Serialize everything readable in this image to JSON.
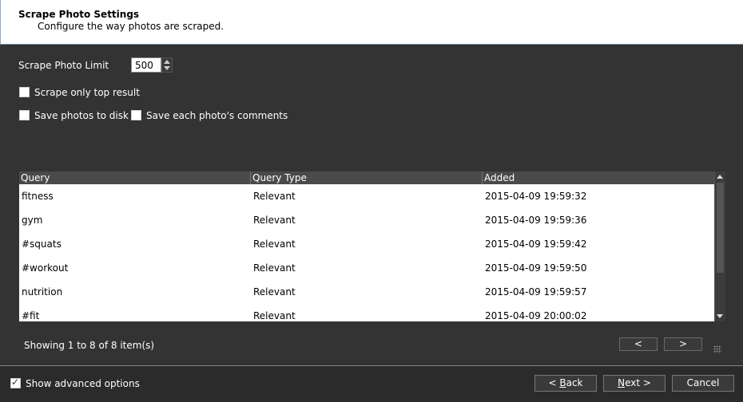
{
  "header": {
    "title": "Scrape Photo Settings",
    "subtitle": "Configure the way photos are scraped."
  },
  "settings": {
    "photo_limit_label": "Scrape Photo Limit",
    "photo_limit_value": "500",
    "scrape_top_label": "Scrape only top result",
    "scrape_top_checked": false,
    "save_disk_label": "Save photos to disk",
    "save_disk_checked": false,
    "save_comments_label": "Save each photo's comments",
    "save_comments_checked": false
  },
  "grid": {
    "columns": [
      "Query",
      "Query Type",
      "Added"
    ],
    "rows": [
      {
        "query": "fitness",
        "type": "Relevant",
        "added": "2015-04-09 19:59:32"
      },
      {
        "query": "gym",
        "type": "Relevant",
        "added": "2015-04-09 19:59:36"
      },
      {
        "query": "#squats",
        "type": "Relevant",
        "added": "2015-04-09 19:59:42"
      },
      {
        "query": "#workout",
        "type": "Relevant",
        "added": "2015-04-09 19:59:50"
      },
      {
        "query": "nutrition",
        "type": "Relevant",
        "added": "2015-04-09 19:59:57"
      },
      {
        "query": "#fit",
        "type": "Relevant",
        "added": "2015-04-09 20:00:02"
      }
    ]
  },
  "pager": {
    "status": "Showing 1 to 8 of 8 item(s)",
    "prev_label": "<",
    "next_label": ">"
  },
  "footer": {
    "advanced_label": "Show advanced options",
    "advanced_checked": true,
    "back_prefix": "< ",
    "back_accel": "B",
    "back_suffix": "ack",
    "next_accel": "N",
    "next_suffix": "ext >",
    "cancel_label": "Cancel"
  },
  "colors": {
    "background": "#2b2b2b",
    "panel": "#333333",
    "header_bg": "#ffffff"
  }
}
